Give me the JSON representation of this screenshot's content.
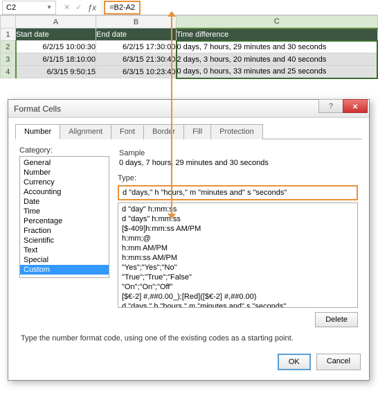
{
  "formula_bar": {
    "name_box": "C2",
    "formula": "=B2-A2"
  },
  "grid": {
    "cols": [
      "A",
      "B",
      "C"
    ],
    "row_nums": [
      "1",
      "2",
      "3",
      "4"
    ],
    "headers": [
      "Start date",
      "End date",
      "Time difference"
    ],
    "rows": [
      [
        "6/2/15 10:00:30",
        "6/2/15 17:30:00",
        "0 days, 7 hours, 29 minutes and 30 seconds"
      ],
      [
        "6/1/15 18:10:00",
        "6/3/15 21:30:40",
        "2 days, 3 hours, 20 minutes and 40 seconds"
      ],
      [
        "6/3/15 9:50:15",
        "6/3/15 10:23:40",
        "0 days, 0 hours, 33 minutes and 25 seconds"
      ]
    ]
  },
  "dialog": {
    "title": "Format Cells",
    "tabs": [
      "Number",
      "Alignment",
      "Font",
      "Border",
      "Fill",
      "Protection"
    ],
    "category_label": "Category:",
    "categories": [
      "General",
      "Number",
      "Currency",
      "Accounting",
      "Date",
      "Time",
      "Percentage",
      "Fraction",
      "Scientific",
      "Text",
      "Special",
      "Custom"
    ],
    "sample_label": "Sample",
    "sample": "0 days, 7 hours, 29 minutes and 30 seconds",
    "type_label": "Type:",
    "type_value": "d \"days,\" h \"hours,\" m \"minutes and\" s \"seconds\"",
    "types": [
      "d \"day\" h:mm:ss",
      "d \"days\" h:mm:ss",
      "[$-409]h:mm:ss AM/PM",
      "h:mm;@",
      " h:mm AM/PM",
      "h:mm:ss AM/PM",
      "\"Yes\";\"Yes\";\"No\"",
      "\"True\";\"True\";\"False\"",
      "\"On\";\"On\";\"Off\"",
      "[$€-2] #,##0.00_);[Red]([$€-2] #,##0.00)",
      "d \"days,\" h \"hours,\" m \"minutes and\" s \"seconds\""
    ],
    "delete": "Delete",
    "hint": "Type the number format code, using one of the existing codes as a starting point.",
    "ok": "OK",
    "cancel": "Cancel",
    "help": "?",
    "close": "×"
  }
}
